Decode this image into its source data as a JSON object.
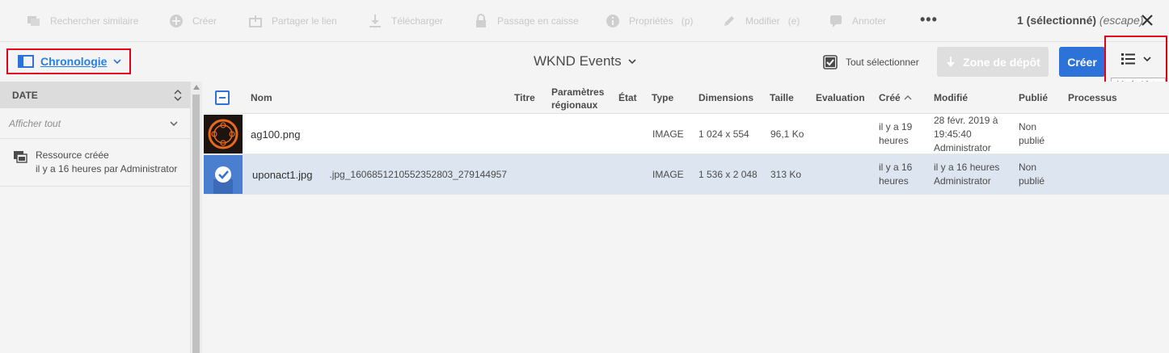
{
  "actions": [
    {
      "label": "Rechercher similaire",
      "icon": "find-similar-icon"
    },
    {
      "label": "Créer",
      "icon": "add-circle-icon"
    },
    {
      "label": "Partager le lien",
      "icon": "share-link-icon"
    },
    {
      "label": "Télécharger",
      "icon": "download-icon"
    },
    {
      "label": "Passage en caisse",
      "icon": "lock-icon"
    },
    {
      "label": "Propriétés",
      "shortcut": "(p)",
      "icon": "info-icon"
    },
    {
      "label": "Modifier",
      "shortcut": "(e)",
      "icon": "edit-icon"
    },
    {
      "label": "Annoter",
      "icon": "annotate-icon"
    }
  ],
  "more_label": "•••",
  "selection": {
    "count": "1 (sélectionné)",
    "escape": "(escape)"
  },
  "rail_toggle": {
    "label": "Chronologie",
    "icon": "timeline-rail-icon"
  },
  "folder_title": "WKND Events",
  "select_all_label": "Tout sélectionner",
  "dropzone_label": "Zone de dépôt",
  "create_label": "Créer",
  "view_tooltip": "Mode Liste",
  "rail": {
    "header": "DATE",
    "filter": "Afficher tout",
    "items": [
      {
        "title": "Ressource créée",
        "detail": "il y a 16 heures par Administrator"
      }
    ]
  },
  "table": {
    "columns": {
      "name": "Nom",
      "title": "Titre",
      "locale": "Paramètres régionaux",
      "locale_l1": "Paramètres",
      "locale_l2": "régionaux",
      "state": "État",
      "type": "Type",
      "dimensions": "Dimensions",
      "size": "Taille",
      "rating": "Evaluation",
      "created": "Créé",
      "modified": "Modifié",
      "published": "Publié",
      "processes": "Processus"
    },
    "rows": [
      {
        "name": "ag100.png",
        "title": "",
        "type": "IMAGE",
        "dimensions": "1 024 x 554",
        "size": "96,1 Ko",
        "created_l1": "il y a 19",
        "created_l2": "heures",
        "modified_l1": "28 févr. 2019 à",
        "modified_l2": "19:45:40",
        "modified_by": "Administrator",
        "published_l1": "Non",
        "published_l2": "publié",
        "selected": false
      },
      {
        "name": "uponact1.jpg",
        "title": "279144957_1606851210552352803_n.jpg",
        "type": "IMAGE",
        "dimensions": "1 536 x 2 048",
        "size": "313 Ko",
        "created_l1": "il y a 16",
        "created_l2": "heures",
        "modified_l1": "il y a 16 heures",
        "modified_by": "Administrator",
        "published_l1": "Non",
        "published_l2": "publié",
        "selected": true
      }
    ]
  },
  "colors": {
    "accent": "#2d72d9",
    "highlight": "#e3001b",
    "selected_row": "#dde6f0"
  }
}
